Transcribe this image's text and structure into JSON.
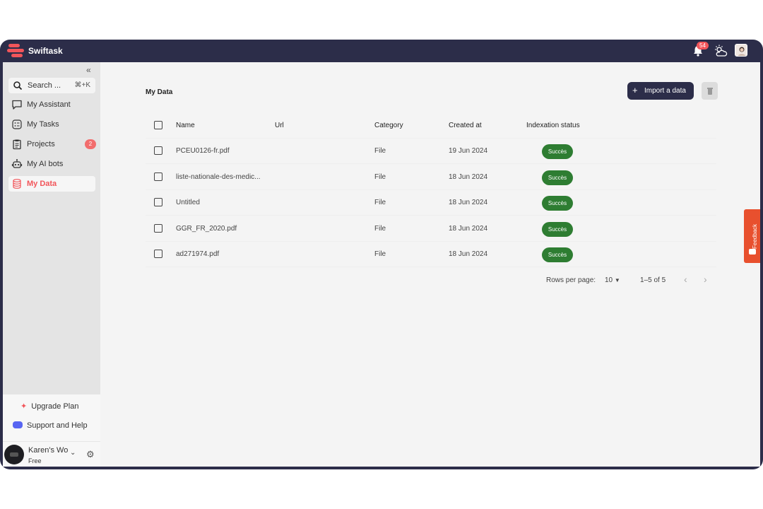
{
  "app": {
    "name": "Swiftask",
    "notification_count": "54"
  },
  "sidebar": {
    "search": {
      "label": "Search ...",
      "shortcut": "⌘+K"
    },
    "items": [
      {
        "label": "My Assistant",
        "icon": "chat-icon"
      },
      {
        "label": "My Tasks",
        "icon": "tasks-icon"
      },
      {
        "label": "Projects",
        "icon": "clipboard-icon",
        "badge": "2"
      },
      {
        "label": "My AI bots",
        "icon": "robot-icon"
      },
      {
        "label": "My Data",
        "icon": "database-icon",
        "active": true
      }
    ],
    "upgrade_label": "Upgrade Plan",
    "support_label": "Support and Help",
    "user": {
      "name": "Karen's Wo",
      "plan": "Free"
    }
  },
  "main": {
    "title": "My Data",
    "import_label": "Import a data",
    "table": {
      "headers": {
        "name": "Name",
        "url": "Url",
        "category": "Category",
        "created": "Created at",
        "status": "Indexation status"
      },
      "rows": [
        {
          "name": "PCEU0126-fr.pdf",
          "url": "",
          "category": "File",
          "created": "19 Jun 2024",
          "status": "Succès"
        },
        {
          "name": "liste-nationale-des-medic...",
          "url": "",
          "category": "File",
          "created": "18 Jun 2024",
          "status": "Succès"
        },
        {
          "name": "Untitled",
          "url": "",
          "category": "File",
          "created": "18 Jun 2024",
          "status": "Succès"
        },
        {
          "name": "GGR_FR_2020.pdf",
          "url": "",
          "category": "File",
          "created": "18 Jun 2024",
          "status": "Succès"
        },
        {
          "name": "ad271974.pdf",
          "url": "",
          "category": "File",
          "created": "18 Jun 2024",
          "status": "Succès"
        }
      ]
    },
    "pagination": {
      "rows_per_page_label": "Rows per page:",
      "rows_per_page_value": "10",
      "range": "1–5 of 5"
    }
  },
  "feedback_label": "Feedback",
  "colors": {
    "accent": "#f2555a",
    "topbar": "#2c2d49",
    "success": "#2e7d32",
    "feedback": "#e8502e"
  }
}
